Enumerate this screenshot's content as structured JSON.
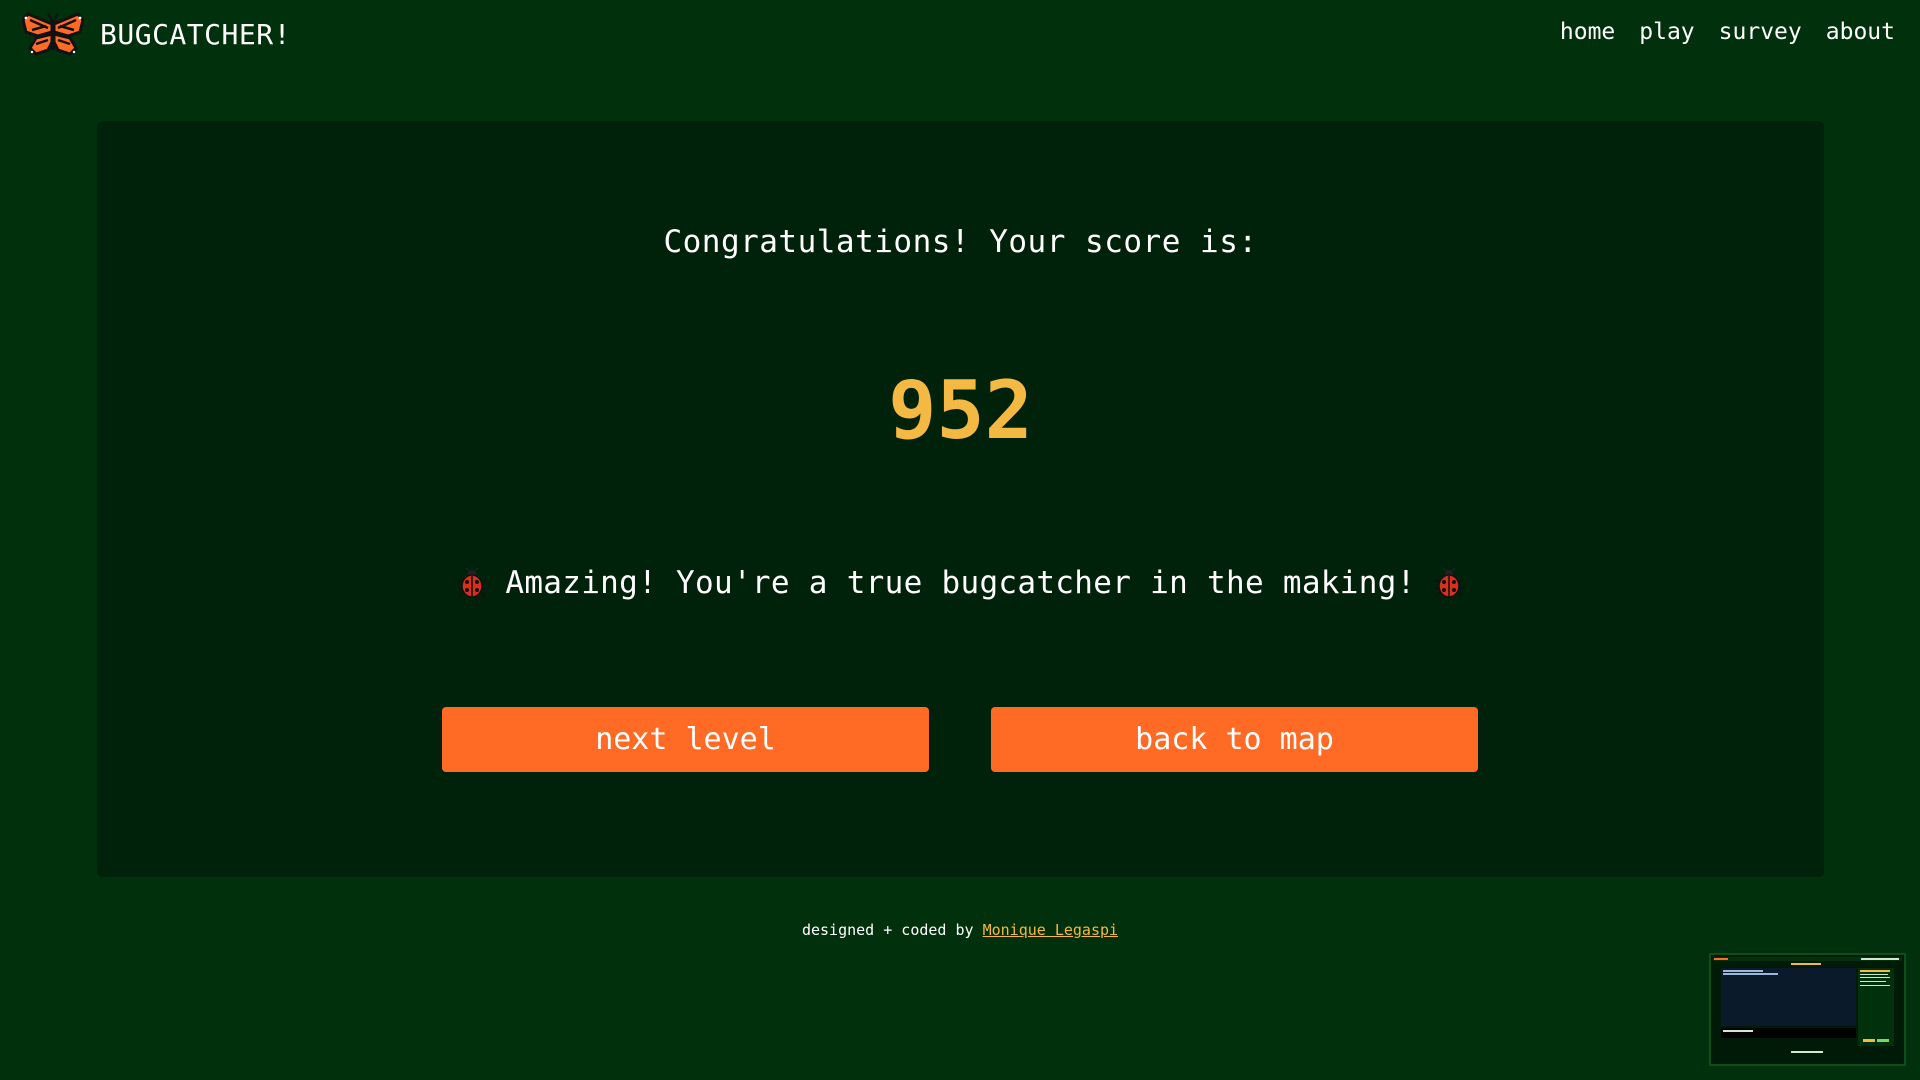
{
  "header": {
    "brand_name": "BUGCATCHER!",
    "logo_icon": "butterfly-icon",
    "nav": [
      {
        "label": "home"
      },
      {
        "label": "play"
      },
      {
        "label": "survey"
      },
      {
        "label": "about"
      }
    ]
  },
  "result": {
    "congrats_text": "Congratulations! Your score is:",
    "score": "952",
    "message": "Amazing! You're a true bugcatcher in the making!",
    "message_icon": "ladybug-icon"
  },
  "buttons": {
    "next_label": "next level",
    "map_label": "back to map"
  },
  "footer": {
    "prefix": "designed + coded by",
    "author": "Monique Legaspi"
  },
  "colors": {
    "page_background": "#00300c",
    "card_background": "#00210a",
    "score_color": "#f4b942",
    "button_color": "#ff6a24",
    "link_color": "#f4b942"
  }
}
